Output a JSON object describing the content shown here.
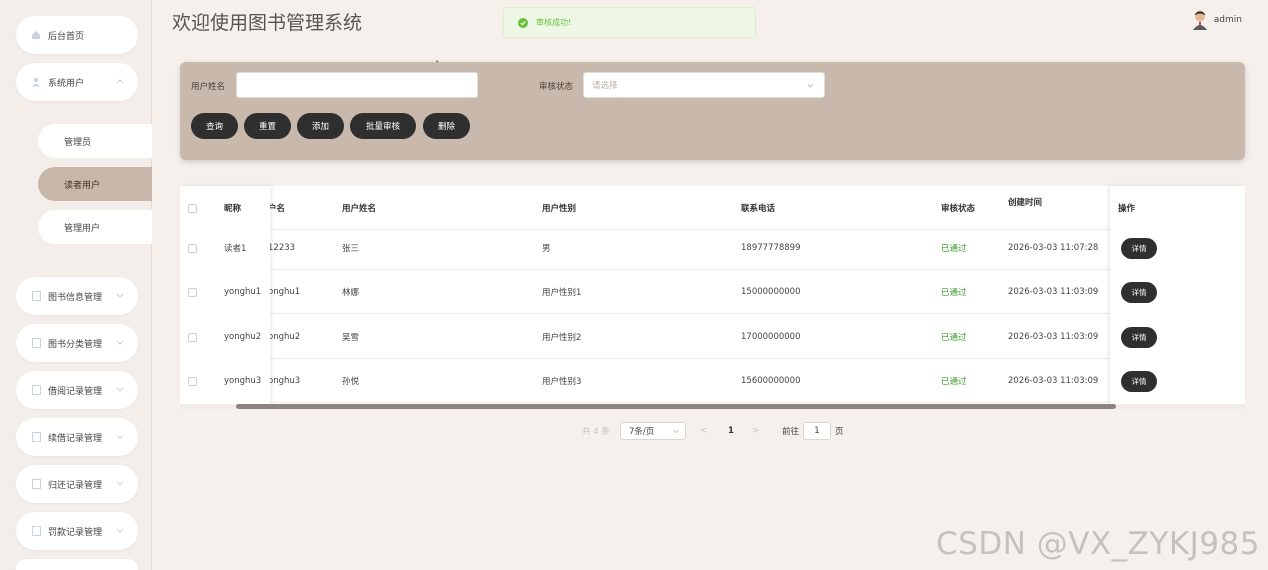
{
  "sidebar": {
    "home": {
      "label": "后台首页",
      "icon": "home-icon"
    },
    "system_users": {
      "label": "系统用户",
      "icon": "user-icon"
    },
    "sub_items": [
      {
        "label": "管理员"
      },
      {
        "label": "读者用户"
      },
      {
        "label": "管理用户"
      }
    ],
    "groups": [
      {
        "label": "图书信息管理"
      },
      {
        "label": "图书分类管理"
      },
      {
        "label": "借阅记录管理"
      },
      {
        "label": "续借记录管理"
      },
      {
        "label": "归还记录管理"
      },
      {
        "label": "罚款记录管理"
      }
    ]
  },
  "header": {
    "title": "欢迎使用图书管理系统",
    "toast": "审核成功!",
    "username": "admin"
  },
  "search": {
    "name_label": "用户姓名",
    "name_value": "",
    "status_label": "审核状态",
    "status_placeholder": "请选择",
    "buttons": {
      "query": "查询",
      "reset": "重置",
      "add": "添加",
      "batch_review": "批量审核",
      "delete": "删除"
    }
  },
  "table": {
    "headers": {
      "nickname": "昵称",
      "username": "户名",
      "realname": "用户姓名",
      "gender": "用户性别",
      "phone": "联系电话",
      "status": "审核状态",
      "created": "创建时间",
      "action": "操作"
    },
    "rows": [
      {
        "nickname": "读者1",
        "username": "12233",
        "realname": "张三",
        "gender": "男",
        "phone": "18977778899",
        "status": "已通过",
        "created": "2026-03-03 11:07:28",
        "action": "详情"
      },
      {
        "nickname": "yonghu1",
        "username": "onghu1",
        "realname": "林娜",
        "gender": "用户性别1",
        "phone": "15000000000",
        "status": "已通过",
        "created": "2026-03-03 11:03:09",
        "action": "详情"
      },
      {
        "nickname": "yonghu2",
        "username": "onghu2",
        "realname": "吴雪",
        "gender": "用户性别2",
        "phone": "17000000000",
        "status": "已通过",
        "created": "2026-03-03 11:03:09",
        "action": "详情"
      },
      {
        "nickname": "yonghu3",
        "username": "onghu3",
        "realname": "孙悦",
        "gender": "用户性别3",
        "phone": "15600000000",
        "status": "已通过",
        "created": "2026-03-03 11:03:09",
        "action": "详情"
      }
    ]
  },
  "pagination": {
    "total": "共 4 条",
    "page_size": "7条/页",
    "prev": "<",
    "current": "1",
    "next": ">",
    "goto_label": "前往",
    "goto_value": "1",
    "page_label": "页"
  },
  "watermark": "CSDN @VX_ZYKJ985",
  "colors": {
    "accent": "#c9b9ac",
    "button": "#2f2f2f",
    "success": "#67c23a",
    "status_text": "#3c9a2e"
  }
}
